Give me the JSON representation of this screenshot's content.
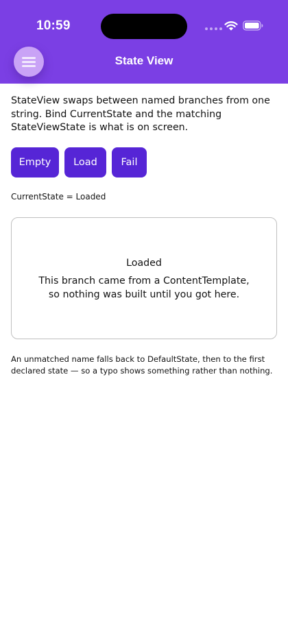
{
  "status_bar": {
    "time": "10:59"
  },
  "nav": {
    "title": "State View",
    "menu_icon": "hamburger-icon"
  },
  "intro": "StateView swaps between named branches from one string. Bind CurrentState and the matching StateViewState is what is on screen.",
  "buttons": {
    "empty_label": "Empty",
    "load_label": "Load",
    "fail_label": "Fail"
  },
  "current_state_text": "CurrentState = Loaded",
  "state_card": {
    "title": "Loaded",
    "body": "This branch came from a ContentTemplate, so nothing was built until you got here."
  },
  "footnote": "An unmatched name falls back to DefaultState, then to the first declared state — so a typo shows something rather than nothing.",
  "colors": {
    "header": "#7b3fe4",
    "button": "#5625d6",
    "menu_button": "#c9a3f6"
  }
}
